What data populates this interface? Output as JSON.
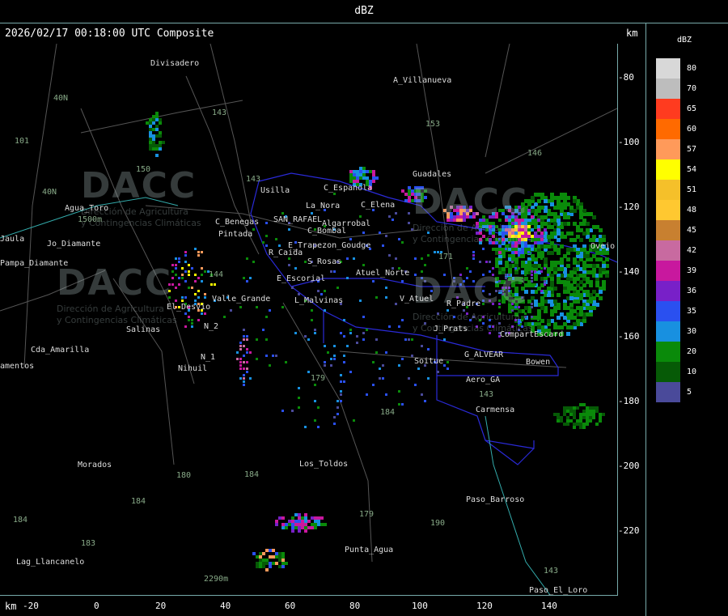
{
  "title": "dBZ",
  "header": {
    "timestamp": "2026/02/17 00:18:00 UTC Composite",
    "unit_top": "km",
    "unit_bottom": "km"
  },
  "y_ticks": [
    "-80",
    "-100",
    "-120",
    "-140",
    "-160",
    "-180",
    "-200",
    "-220"
  ],
  "x_ticks": [
    "-20",
    "0",
    "20",
    "40",
    "60",
    "80",
    "100",
    "120",
    "140"
  ],
  "legend": {
    "title": "dBZ",
    "levels": [
      {
        "label": "80",
        "color": "#d8d8d8"
      },
      {
        "label": "70",
        "color": "#bdbdbd"
      },
      {
        "label": "65",
        "color": "#ff3b1f"
      },
      {
        "label": "60",
        "color": "#ff6a00"
      },
      {
        "label": "57",
        "color": "#ff9a5a"
      },
      {
        "label": "54",
        "color": "#ffff00"
      },
      {
        "label": "51",
        "color": "#f5c02a"
      },
      {
        "label": "48",
        "color": "#ffc830"
      },
      {
        "label": "45",
        "color": "#c88030"
      },
      {
        "label": "42",
        "color": "#c86aa0"
      },
      {
        "label": "39",
        "color": "#c8189e"
      },
      {
        "label": "36",
        "color": "#7820c8"
      },
      {
        "label": "35",
        "color": "#2a50f0"
      },
      {
        "label": "30",
        "color": "#1890e0"
      },
      {
        "label": "20",
        "color": "#0a8a0a"
      },
      {
        "label": "10",
        "color": "#065a06"
      },
      {
        "label": "5",
        "color": "#4a4a9a"
      }
    ]
  },
  "places": [
    {
      "name": "Divisadero"
    },
    {
      "name": "A_Villanueva"
    },
    {
      "name": "Guadales"
    },
    {
      "name": "Usilla"
    },
    {
      "name": "La_Nora"
    },
    {
      "name": "C_Espanola"
    },
    {
      "name": "C_Elena"
    },
    {
      "name": "Agua_Toro"
    },
    {
      "name": "SAN_RAFAEL"
    },
    {
      "name": "Algarrobal"
    },
    {
      "name": "C_Bombal"
    },
    {
      "name": "C_Benegas"
    },
    {
      "name": "Pintada"
    },
    {
      "name": "Pampa_Diamante"
    },
    {
      "name": "R_Caida"
    },
    {
      "name": "E_Trapezon_Goudge"
    },
    {
      "name": "S_Rosas"
    },
    {
      "name": "Atuel_Norte"
    },
    {
      "name": "E_Escorial"
    },
    {
      "name": "El_Desvio"
    },
    {
      "name": "Valle_Grande"
    },
    {
      "name": "L_Malvinas"
    },
    {
      "name": "V_Atuel"
    },
    {
      "name": "R_Padre"
    },
    {
      "name": "Salinas"
    },
    {
      "name": "J_Prats"
    },
    {
      "name": "CompartEscard"
    },
    {
      "name": "Cda_Amarilla"
    },
    {
      "name": "N_1"
    },
    {
      "name": "Nihuil"
    },
    {
      "name": "G_ALVEAR"
    },
    {
      "name": "Soitue"
    },
    {
      "name": "Bowen"
    },
    {
      "name": "Aero_GA"
    },
    {
      "name": "Carmensa"
    },
    {
      "name": "Morados"
    },
    {
      "name": "Los_Toldos"
    },
    {
      "name": "Paso_Barroso"
    },
    {
      "name": "Punta_Agua"
    },
    {
      "name": "Lag_Llancanelo"
    },
    {
      "name": "Paso_El_Loro"
    },
    {
      "name": "Jaula"
    },
    {
      "name": "amentos"
    },
    {
      "name": "Ovejo"
    },
    {
      "name": "N_2"
    },
    {
      "name": "Jo_Diamante"
    }
  ],
  "distances": [
    {
      "label": "143"
    },
    {
      "label": "153"
    },
    {
      "label": "146"
    },
    {
      "label": "101"
    },
    {
      "label": "40N"
    },
    {
      "label": "40N"
    },
    {
      "label": "150"
    },
    {
      "label": "143"
    },
    {
      "label": "171"
    },
    {
      "label": "144"
    },
    {
      "label": "179"
    },
    {
      "label": "184"
    },
    {
      "label": "180"
    },
    {
      "label": "184"
    },
    {
      "label": "179"
    },
    {
      "label": "190"
    },
    {
      "label": "143"
    },
    {
      "label": "184"
    },
    {
      "label": "183"
    },
    {
      "label": "184"
    },
    {
      "label": "143"
    },
    {
      "label": "2290m"
    },
    {
      "label": "1500m"
    }
  ],
  "watermark": {
    "logo": "DACC",
    "line1": "Dirección de Agricultura",
    "line2": "y Contingencias Climáticas"
  }
}
